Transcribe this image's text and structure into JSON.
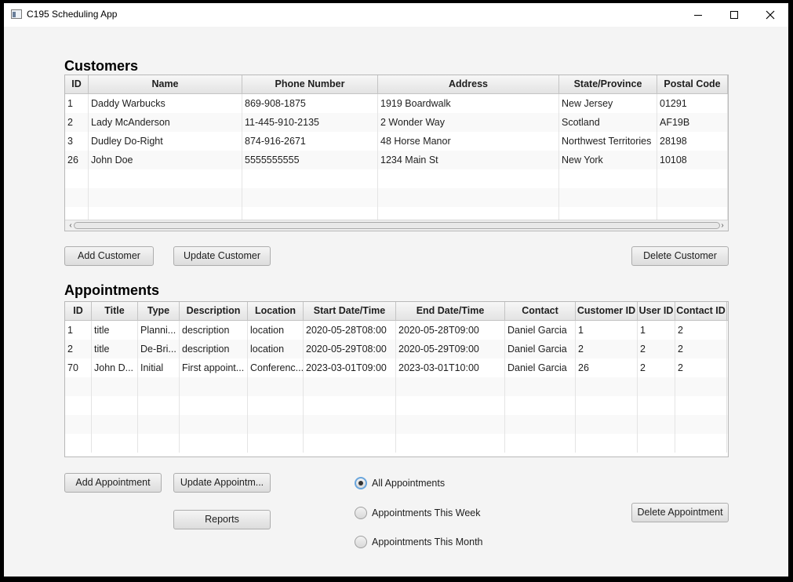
{
  "window": {
    "title": "C195 Scheduling App"
  },
  "customers": {
    "heading": "Customers",
    "columns": [
      "ID",
      "Name",
      "Phone Number",
      "Address",
      "State/Province",
      "Postal Code"
    ],
    "rows": [
      [
        "1",
        "Daddy Warbucks",
        "869-908-1875",
        "1919 Boardwalk",
        "New Jersey",
        "01291"
      ],
      [
        "2",
        "Lady McAnderson",
        "11-445-910-2135",
        "2 Wonder Way",
        "Scotland",
        "AF19B"
      ],
      [
        "3",
        "Dudley Do-Right",
        "874-916-2671",
        "48 Horse Manor",
        "Northwest Territories",
        "28198"
      ],
      [
        "26",
        "John Doe",
        "5555555555",
        "1234 Main St",
        "New York",
        "10108"
      ]
    ],
    "add_label": "Add Customer",
    "update_label": "Update Customer",
    "delete_label": "Delete Customer"
  },
  "appointments": {
    "heading": "Appointments",
    "columns": [
      "ID",
      "Title",
      "Type",
      "Description",
      "Location",
      "Start Date/Time",
      "End Date/Time",
      "Contact",
      "Customer ID",
      "User ID",
      "Contact ID"
    ],
    "rows": [
      [
        "1",
        "title",
        "Planni...",
        "description",
        "location",
        "2020-05-28T08:00",
        "2020-05-28T09:00",
        "Daniel Garcia",
        "1",
        "1",
        "2"
      ],
      [
        "2",
        "title",
        "De-Bri...",
        "description",
        "location",
        "2020-05-29T08:00",
        "2020-05-29T09:00",
        "Daniel Garcia",
        "2",
        "2",
        "2"
      ],
      [
        "70",
        "John D...",
        "Initial",
        "First appoint...",
        "Conferenc...",
        "2023-03-01T09:00",
        "2023-03-01T10:00",
        "Daniel Garcia",
        "26",
        "2",
        "2"
      ]
    ],
    "add_label": "Add Appointment",
    "update_label": "Update Appointm...",
    "reports_label": "Reports",
    "delete_label": "Delete Appointment",
    "filters": [
      {
        "label": "All Appointments",
        "selected": true
      },
      {
        "label": "Appointments This Week",
        "selected": false
      },
      {
        "label": "Appointments This Month",
        "selected": false
      }
    ]
  }
}
